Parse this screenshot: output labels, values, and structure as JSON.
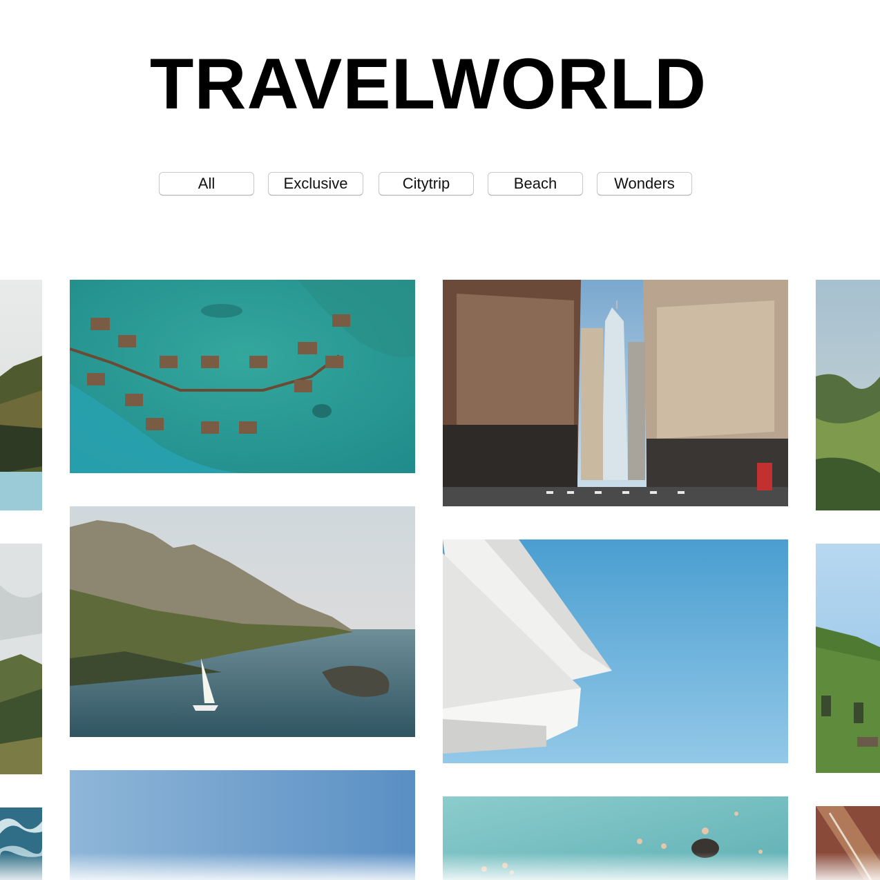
{
  "site": {
    "title": "TRAVELWORLD"
  },
  "filters": [
    {
      "label": "All"
    },
    {
      "label": "Exclusive"
    },
    {
      "label": "Citytrip"
    },
    {
      "label": "Beach"
    },
    {
      "label": "Wonders"
    }
  ],
  "photos": [
    {
      "subject": "aerial-overwater-villas"
    },
    {
      "subject": "new-york-street-skyscraper"
    },
    {
      "subject": "rocky-coast-sailboat"
    },
    {
      "subject": "white-architecture-blue-sky"
    },
    {
      "subject": "clear-sky"
    },
    {
      "subject": "swimmers-turquoise-sea"
    },
    {
      "subject": "mountain-lake-partial"
    },
    {
      "subject": "green-hills-partial"
    },
    {
      "subject": "misty-hills-partial"
    },
    {
      "subject": "ivy-covered-building-partial"
    },
    {
      "subject": "ocean-waves-partial"
    },
    {
      "subject": "red-cliff-partial"
    }
  ],
  "colors": {
    "background": "#ffffff",
    "title": "#000000",
    "button_border": "#c8c8c8"
  }
}
